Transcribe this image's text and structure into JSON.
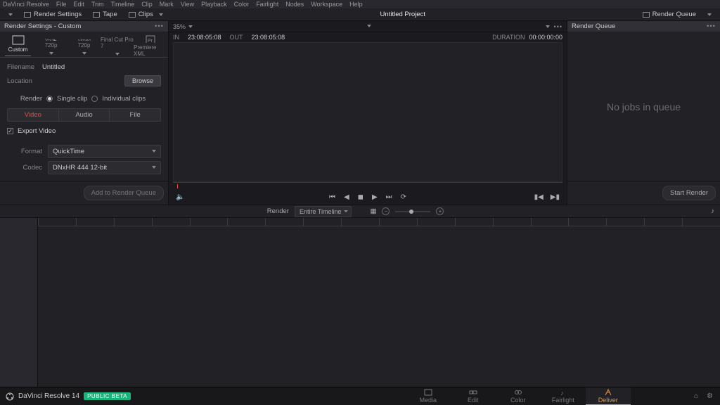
{
  "app": "DaVinci Resolve",
  "menu": [
    "File",
    "Edit",
    "Trim",
    "Timeline",
    "Clip",
    "Mark",
    "View",
    "Playback",
    "Color",
    "Fairlight",
    "Nodes",
    "Workspace",
    "Help"
  ],
  "toolbar": {
    "render_settings": "Render Settings",
    "tape": "Tape",
    "clips": "Clips",
    "project": "Untitled Project",
    "render_queue": "Render Queue"
  },
  "left": {
    "title": "Render Settings - Custom",
    "presets": [
      {
        "label": "Custom"
      },
      {
        "label": "720p"
      },
      {
        "label": "720p"
      },
      {
        "label": "Final Cut Pro 7"
      },
      {
        "label": "Premiere XML"
      }
    ],
    "filename_label": "Filename",
    "filename_value": "Untitled",
    "location_label": "Location",
    "browse": "Browse",
    "render_label": "Render",
    "single": "Single clip",
    "individual": "Individual clips",
    "tabs": [
      "Video",
      "Audio",
      "File"
    ],
    "export_video": "Export Video",
    "format_label": "Format",
    "format_value": "QuickTime",
    "codec_label": "Codec",
    "codec_value": "DNxHR 444 12-bit",
    "add_btn": "Add to Render Queue"
  },
  "viewer": {
    "zoom": "35%",
    "in_label": "IN",
    "in_tc": "23:08:05:08",
    "out_label": "OUT",
    "out_tc": "23:08:05:08",
    "dur_label": "DURATION",
    "dur_tc": "00:00:00:00"
  },
  "right": {
    "title": "Render Queue",
    "empty": "No jobs in queue",
    "start": "Start Render"
  },
  "tlbar": {
    "render": "Render",
    "mode": "Entire Timeline"
  },
  "pages": [
    "Media",
    "Edit",
    "Color",
    "Fairlight",
    "Deliver"
  ],
  "footer": {
    "product": "DaVinci Resolve 14",
    "beta": "PUBLIC BETA"
  }
}
